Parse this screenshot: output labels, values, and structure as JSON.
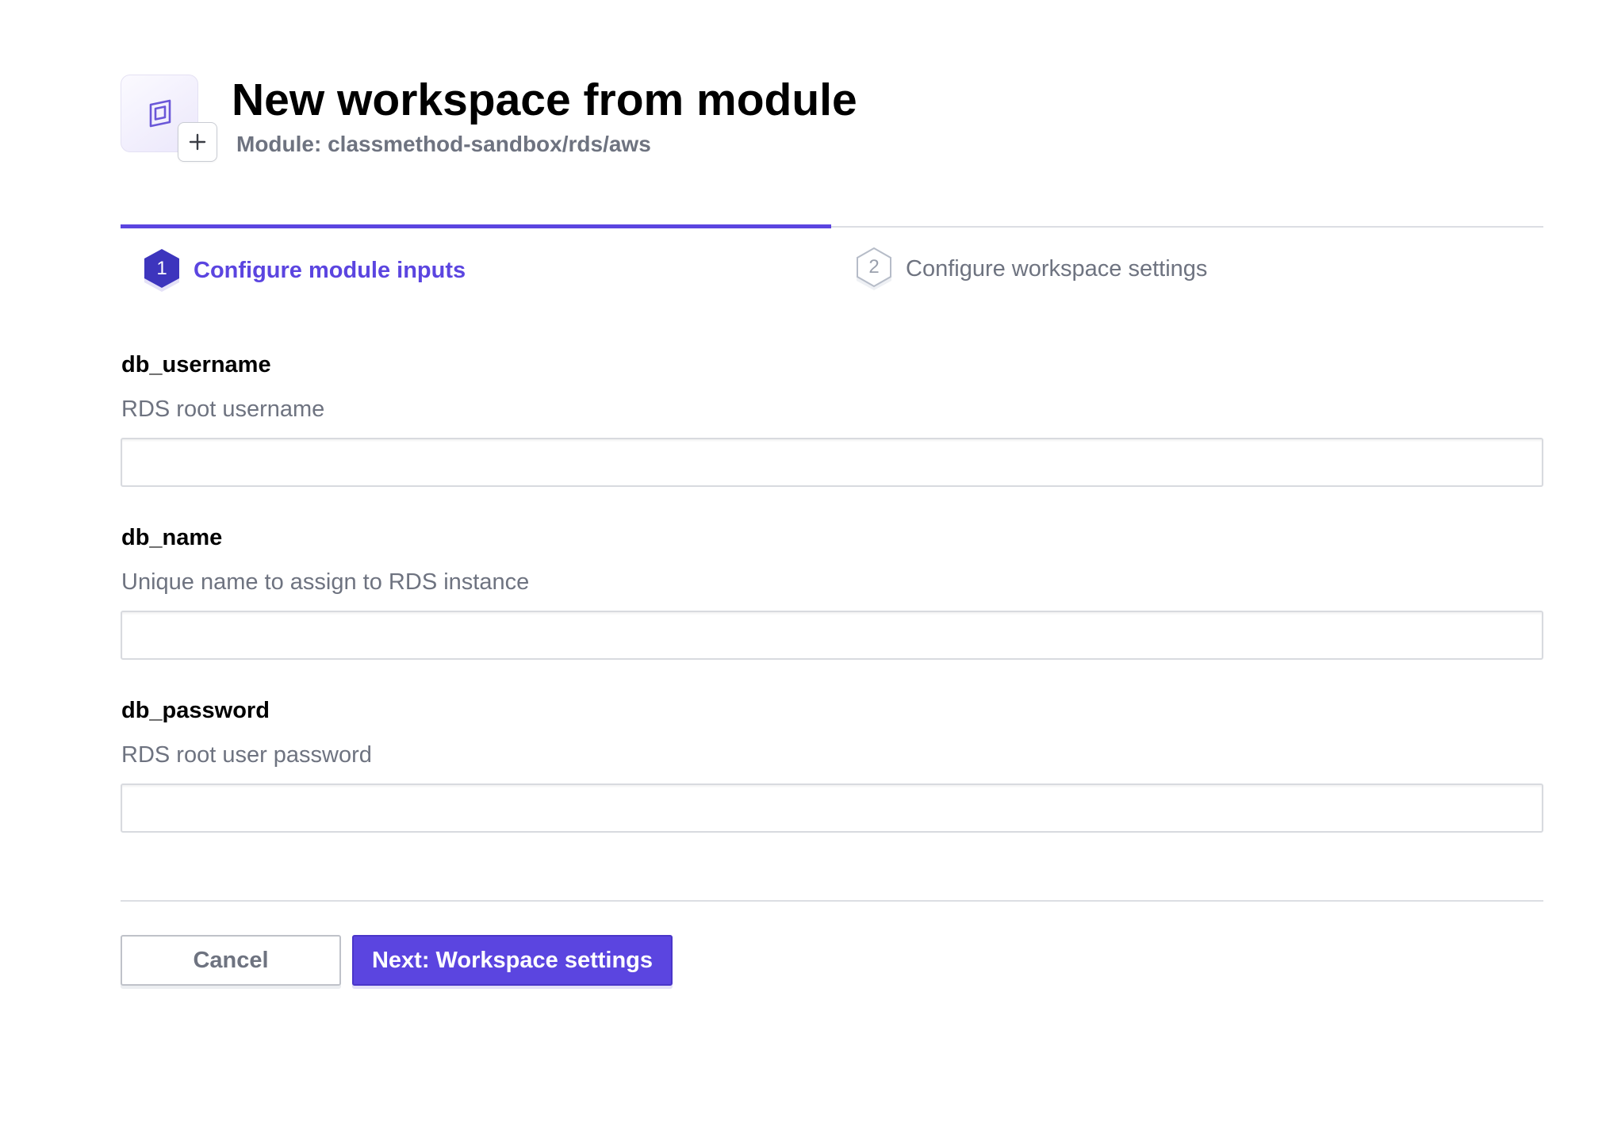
{
  "header": {
    "title": "New workspace from module",
    "subtitle": "Module: classmethod-sandbox/rds/aws",
    "module_icon": "module-icon",
    "plus_icon": "plus-icon"
  },
  "steps": [
    {
      "number": "1",
      "label": "Configure module inputs",
      "active": true
    },
    {
      "number": "2",
      "label": "Configure workspace settings",
      "active": false
    }
  ],
  "fields": [
    {
      "name": "db_username",
      "description": "RDS root username",
      "value": ""
    },
    {
      "name": "db_name",
      "description": "Unique name to assign to RDS instance",
      "value": ""
    },
    {
      "name": "db_password",
      "description": "RDS root user password",
      "value": ""
    }
  ],
  "actions": {
    "cancel_label": "Cancel",
    "next_label": "Next: Workspace settings"
  },
  "colors": {
    "accent": "#5b45e0",
    "muted_text": "#6e7380",
    "border": "#dcdee3"
  }
}
